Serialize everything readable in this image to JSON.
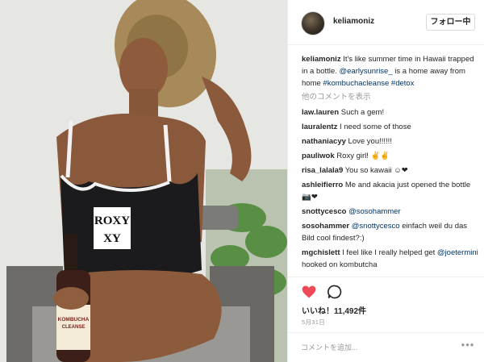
{
  "post": {
    "username": "keliamoniz",
    "follow_label": "フォロー中",
    "caption": {
      "user": "keliamoniz",
      "text": " It's like summer time in Hawaii trapped in a bottle. ",
      "mention": "@earlysunrise_",
      "text2": " is a home away from home ",
      "hashtag1": "#kombuchacleanse",
      "hashtag2": "#detox"
    },
    "show_more": "他のコメントを表示",
    "comments": [
      {
        "user": "law.lauren",
        "text": " Such a gem!"
      },
      {
        "user": "lauralentz",
        "text": " I need some of those"
      },
      {
        "user": "nathaniacyy",
        "text": " Love you!!!!!!"
      },
      {
        "user": "pauliwok",
        "text": " Roxy girl! ✌✌"
      },
      {
        "user": "risa_lalala9",
        "text": " You so kawaii ☺❤"
      },
      {
        "user": "ashleifierro",
        "text": " Me and akacia just opened the bottle 📷❤"
      },
      {
        "user": "snottycesco",
        "mention": " @sosohammer"
      },
      {
        "user": "sosohammer",
        "mention": " @snottycesco",
        "text": " einfach weil du das Bild cool findest?:)"
      },
      {
        "user": "mgchislett",
        "text": " I feel like I really helped get ",
        "mention": "@joetermini",
        "text2": " hooked on kombutcha"
      }
    ],
    "likes_text": "いいね！11,492件",
    "date": "5月31日",
    "comment_placeholder": "コメントを追加...",
    "more_icon": "ellipsis-icon",
    "colors": {
      "heart": "#ed4956",
      "link": "#003569",
      "muted": "#999999"
    },
    "photo": {
      "swimsuit_text_line1": "ROXY",
      "swimsuit_text_line2": "XY",
      "label_text_line1": "KOMBUCHA",
      "label_text_line2": "CLEANSE"
    }
  }
}
